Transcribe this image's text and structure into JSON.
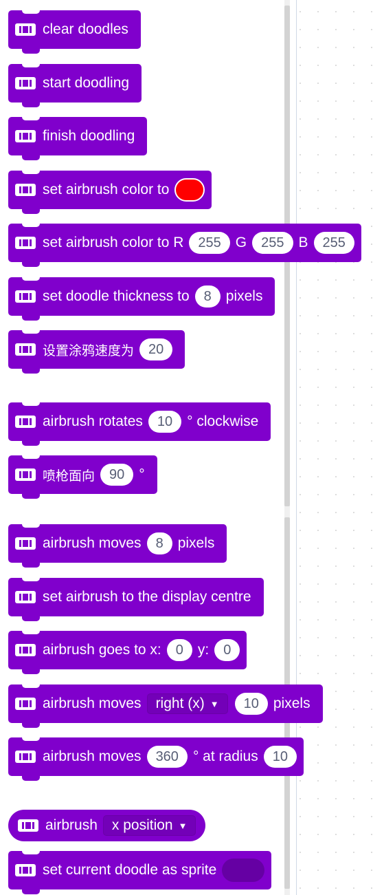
{
  "palette": {
    "accent_color": "#8000cc",
    "icon": "extension-display-icon",
    "blocks": [
      {
        "id": "clear",
        "text": "clear doodles"
      },
      {
        "id": "start",
        "text": "start doodling"
      },
      {
        "id": "finish",
        "text": "finish doodling"
      },
      {
        "id": "set_color",
        "text": "set airbrush color to",
        "swatch_color": "#ff0000"
      },
      {
        "id": "set_rgb",
        "t1": "set airbrush color to R",
        "r": "255",
        "t2": "G",
        "g": "255",
        "t3": "B",
        "b": "255"
      },
      {
        "id": "thickness",
        "t1": "set doodle thickness to",
        "value": "8",
        "t2": "pixels"
      },
      {
        "id": "speed",
        "t1": "设置涂鸦速度为",
        "value": "20"
      },
      {
        "id": "rotate",
        "t1": "airbrush rotates",
        "value": "10",
        "t2": "° clockwise"
      },
      {
        "id": "face",
        "t1": "喷枪面向",
        "value": "90",
        "t2": "°"
      },
      {
        "id": "move",
        "t1": "airbrush moves",
        "value": "8",
        "t2": "pixels"
      },
      {
        "id": "centre",
        "text": "set airbrush to the display centre"
      },
      {
        "id": "goto",
        "t1": "airbrush goes to x:",
        "x": "0",
        "t2": "y:",
        "y": "0"
      },
      {
        "id": "move_dir",
        "t1": "airbrush moves",
        "dropdown": "right (x)",
        "value": "10",
        "t2": "pixels"
      },
      {
        "id": "arc",
        "t1": "airbrush moves",
        "angle": "360",
        "t2": "° at radius",
        "radius": "10"
      },
      {
        "id": "position",
        "t1": "airbrush",
        "dropdown": "x position"
      },
      {
        "id": "sprite",
        "t1": "set current doodle as sprite"
      }
    ]
  }
}
